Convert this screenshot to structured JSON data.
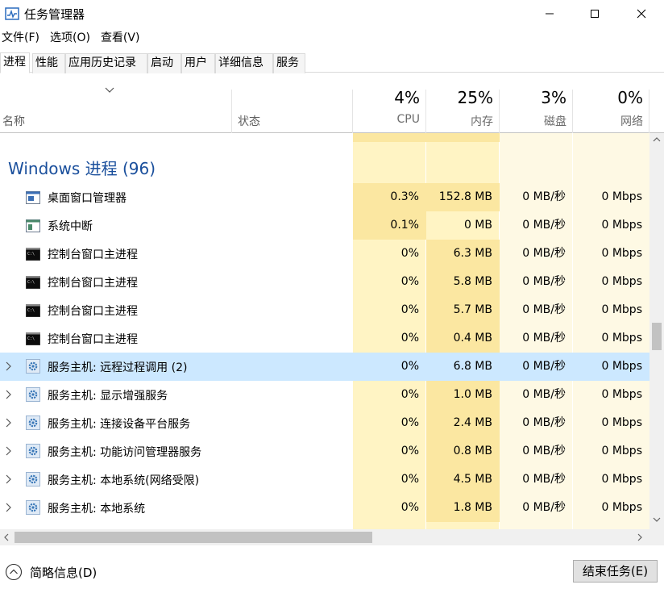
{
  "window": {
    "title": "任务管理器"
  },
  "menu": [
    "文件(F)",
    "选项(O)",
    "查看(V)"
  ],
  "tabs": [
    {
      "label": "进程",
      "active": true
    },
    {
      "label": "性能"
    },
    {
      "label": "应用历史记录"
    },
    {
      "label": "启动"
    },
    {
      "label": "用户"
    },
    {
      "label": "详细信息"
    },
    {
      "label": "服务"
    }
  ],
  "columns": {
    "name": "名称",
    "status": "状态",
    "cpu": {
      "percent": "4%",
      "label": "CPU"
    },
    "memory": {
      "percent": "25%",
      "label": "内存"
    },
    "disk": {
      "percent": "3%",
      "label": "磁盘"
    },
    "network": {
      "percent": "0%",
      "label": "网络"
    }
  },
  "group": {
    "title": "Windows 进程 (96)"
  },
  "rows": [
    {
      "name": "桌面窗口管理器",
      "icon": "dwm-window-icon",
      "expandable": false,
      "cpu": "0.3%",
      "memory": "152.8 MB",
      "disk": "0 MB/秒",
      "network": "0 Mbps"
    },
    {
      "name": "系统中断",
      "icon": "system-interrupt-icon",
      "expandable": false,
      "cpu": "0.1%",
      "memory": "0 MB",
      "disk": "0 MB/秒",
      "network": "0 Mbps"
    },
    {
      "name": "控制台窗口主进程",
      "icon": "console-icon",
      "expandable": false,
      "cpu": "0%",
      "memory": "6.3 MB",
      "disk": "0 MB/秒",
      "network": "0 Mbps"
    },
    {
      "name": "控制台窗口主进程",
      "icon": "console-icon",
      "expandable": false,
      "cpu": "0%",
      "memory": "5.8 MB",
      "disk": "0 MB/秒",
      "network": "0 Mbps"
    },
    {
      "name": "控制台窗口主进程",
      "icon": "console-icon",
      "expandable": false,
      "cpu": "0%",
      "memory": "5.7 MB",
      "disk": "0 MB/秒",
      "network": "0 Mbps"
    },
    {
      "name": "控制台窗口主进程",
      "icon": "console-icon",
      "expandable": false,
      "cpu": "0%",
      "memory": "0.4 MB",
      "disk": "0 MB/秒",
      "network": "0 Mbps"
    },
    {
      "name": "服务主机: 远程过程调用 (2)",
      "icon": "gear-icon",
      "expandable": true,
      "selected": true,
      "cpu": "0%",
      "memory": "6.8 MB",
      "disk": "0 MB/秒",
      "network": "0 Mbps"
    },
    {
      "name": "服务主机: 显示增强服务",
      "icon": "gear-icon",
      "expandable": true,
      "cpu": "0%",
      "memory": "1.0 MB",
      "disk": "0 MB/秒",
      "network": "0 Mbps"
    },
    {
      "name": "服务主机: 连接设备平台服务",
      "icon": "gear-icon",
      "expandable": true,
      "cpu": "0%",
      "memory": "2.4 MB",
      "disk": "0 MB/秒",
      "network": "0 Mbps"
    },
    {
      "name": "服务主机: 功能访问管理器服务",
      "icon": "gear-icon",
      "expandable": true,
      "cpu": "0%",
      "memory": "0.8 MB",
      "disk": "0 MB/秒",
      "network": "0 Mbps"
    },
    {
      "name": "服务主机: 本地系统(网络受限)",
      "icon": "gear-icon",
      "expandable": true,
      "cpu": "0%",
      "memory": "4.5 MB",
      "disk": "0 MB/秒",
      "network": "0 Mbps"
    },
    {
      "name": "服务主机: 本地系统",
      "icon": "gear-icon",
      "expandable": true,
      "cpu": "0%",
      "memory": "1.8 MB",
      "disk": "0 MB/秒",
      "network": "0 Mbps"
    }
  ],
  "footer": {
    "fewer_details": "简略信息(D)",
    "end_task": "结束任务(E)"
  },
  "colors": {
    "heat_strong": "#fbe7a1",
    "heat_light": "#fff4c4",
    "heat_faint": "#fef9e4",
    "selected": "#cce8ff",
    "group_title": "#1a4f9c"
  }
}
